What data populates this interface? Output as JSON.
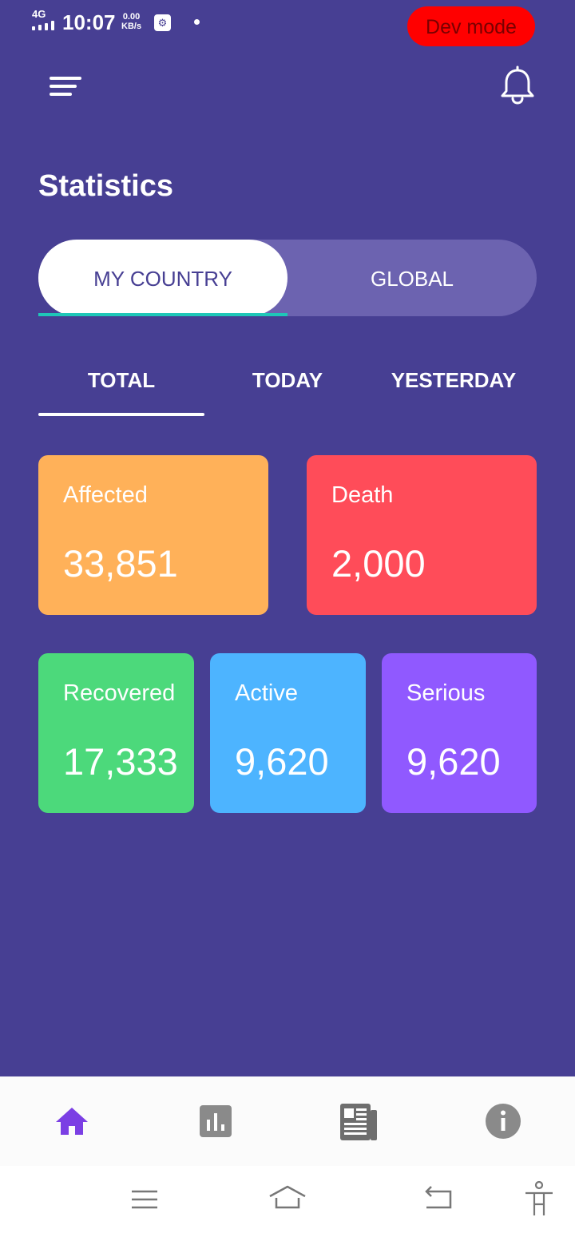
{
  "status_bar": {
    "network": "4G",
    "time": "10:07",
    "speed_value": "0.00",
    "speed_unit": "KB/s",
    "dev_badge": "Dev mode"
  },
  "header": {
    "title": "Statistics",
    "menu_icon": "menu-icon",
    "bell_icon": "bell-icon"
  },
  "scope_toggle": {
    "options": [
      "MY COUNTRY",
      "GLOBAL"
    ],
    "selected": "MY COUNTRY",
    "indicator_color": "#1fc7b8"
  },
  "period_tabs": {
    "items": [
      "TOTAL",
      "TODAY",
      "YESTERDAY"
    ],
    "selected": "TOTAL"
  },
  "stats": {
    "affected": {
      "label": "Affected",
      "value": "33,851",
      "color": "#ffb159"
    },
    "death": {
      "label": "Death",
      "value": "2,000",
      "color": "#ff4c59"
    },
    "recovered": {
      "label": "Recovered",
      "value": "17,333",
      "color": "#4cd97b"
    },
    "active": {
      "label": "Active",
      "value": "9,620",
      "color": "#4db4ff"
    },
    "serious": {
      "label": "Serious",
      "value": "9,620",
      "color": "#9059ff"
    }
  },
  "bottom_nav": {
    "items": [
      "home-icon",
      "bar-chart-icon",
      "newspaper-icon",
      "info-icon"
    ],
    "active": "home-icon",
    "active_color": "#7b3fe4"
  },
  "colors": {
    "background": "#473f93",
    "toggle_track": "#6c63b0"
  }
}
